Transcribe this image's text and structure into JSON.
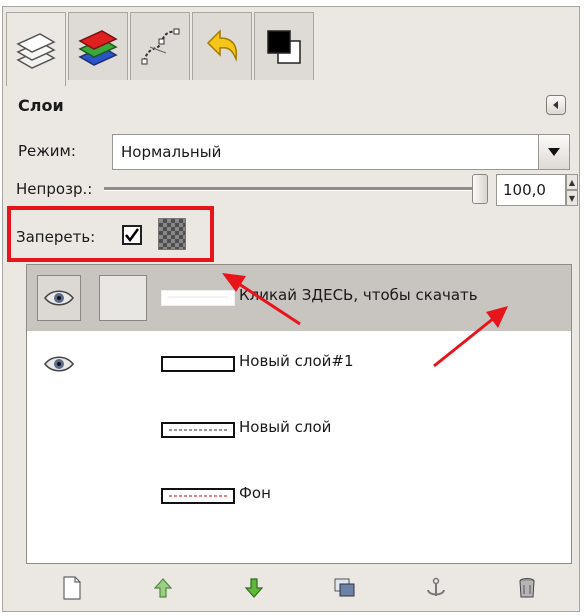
{
  "tabs": [
    {
      "icon": "layers-icon"
    },
    {
      "icon": "channels-icon"
    },
    {
      "icon": "paths-icon"
    },
    {
      "icon": "undo-history-icon"
    },
    {
      "icon": "colors-icon"
    }
  ],
  "panel": {
    "title": "Слои",
    "menu_icon": "panel-menu-icon"
  },
  "mode": {
    "label": "Режим:",
    "value": "Нормальный"
  },
  "opacity": {
    "label": "Непрозр.:",
    "value": "100,0",
    "level_percent": 100
  },
  "lock": {
    "label": "Запереть:",
    "pixels_checked": true
  },
  "layers": [
    {
      "name": "Кликай ЗДЕСЬ, чтобы скачать",
      "visible": true,
      "selected": true
    },
    {
      "name": "Новый слой#1",
      "visible": true,
      "selected": false
    },
    {
      "name": "Новый слой",
      "visible": false,
      "selected": false
    },
    {
      "name": "Фон",
      "visible": false,
      "selected": false
    }
  ],
  "bottom_buttons": [
    {
      "icon": "new-layer-icon"
    },
    {
      "icon": "raise-layer-icon"
    },
    {
      "icon": "lower-layer-icon"
    },
    {
      "icon": "duplicate-layer-icon"
    },
    {
      "icon": "anchor-layer-icon"
    },
    {
      "icon": "delete-layer-icon"
    }
  ],
  "colors": {
    "highlight": "#e8141c",
    "arrows": "#e8141c",
    "selected_row": "#c8c4bf"
  }
}
